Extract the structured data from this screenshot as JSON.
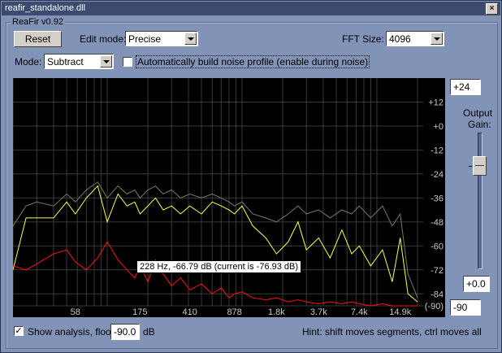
{
  "window": {
    "title": "reafir_standalone.dll",
    "close_glyph": "×"
  },
  "group_label": "ReaFir v0.92",
  "toolbar": {
    "reset_label": "Reset",
    "edit_mode_label": "Edit mode:",
    "edit_mode_value": "Precise",
    "fft_label": "FFT Size:",
    "fft_value": "4096",
    "mode_label": "Mode:",
    "mode_value": "Subtract",
    "auto_label": "Automatically build noise profile (enable during noise)",
    "auto_checked": ""
  },
  "output": {
    "max_value": "+24",
    "label_line1": "Output",
    "label_line2": "Gain:",
    "gain_value": "+0.0",
    "min_value": "-90"
  },
  "footer": {
    "show_check": "✓",
    "show_label": "Show analysis, floor:",
    "floor_value": "-90.0",
    "db_label": "dB",
    "hint": "Hint: shift moves segments, ctrl moves all"
  },
  "tooltip_text": "228 Hz,  -66.79 dB (current is -76.93 dB)",
  "colors": {
    "analysis": "#ffff44",
    "profile": "#ff1010",
    "prev": "#7a7a5a",
    "grid": "#3a3a3a"
  },
  "chart_data": {
    "type": "line",
    "xlabels": [
      {
        "f": 58,
        "label": "58"
      },
      {
        "f": 175,
        "label": "175"
      },
      {
        "f": 410,
        "label": "410"
      },
      {
        "f": 878,
        "label": "878"
      },
      {
        "f": 1800,
        "label": "1.8k"
      },
      {
        "f": 3700,
        "label": "3.7k"
      },
      {
        "f": 7400,
        "label": "7.4k"
      },
      {
        "f": 14900,
        "label": "14.9k"
      }
    ],
    "ylabels": [
      {
        "v": 12,
        "label": "+12"
      },
      {
        "v": 0,
        "label": "+0"
      },
      {
        "v": -12,
        "label": "-12"
      },
      {
        "v": -24,
        "label": "-24"
      },
      {
        "v": -36,
        "label": "-36"
      },
      {
        "v": -48,
        "label": "-48"
      },
      {
        "v": -60,
        "label": "-60"
      },
      {
        "v": -72,
        "label": "-72"
      },
      {
        "v": -84,
        "label": "-84"
      },
      {
        "v": -90,
        "label": "(-90)"
      }
    ],
    "xrange": [
      20,
      22050
    ],
    "yrange": [
      -90,
      24
    ],
    "xscale": "log",
    "profile": {
      "x": [
        20,
        25,
        30,
        40,
        50,
        58,
        70,
        85,
        100,
        120,
        140,
        160,
        175,
        200,
        228,
        260,
        300,
        350,
        410,
        500,
        600,
        700,
        800,
        878,
        1000,
        1200,
        1500,
        1800,
        2200,
        2600,
        3000,
        3700,
        4500,
        5500,
        6500,
        7400,
        9000,
        11000,
        13000,
        14900,
        17000,
        20000
      ],
      "y": [
        -70,
        -72,
        -69,
        -64,
        -62,
        -68,
        -72,
        -66,
        -58,
        -67,
        -72,
        -76,
        -70,
        -78,
        -67,
        -74,
        -80,
        -76,
        -82,
        -79,
        -84,
        -81,
        -86,
        -84,
        -83,
        -86,
        -87,
        -86,
        -88,
        -87,
        -88,
        -89,
        -88,
        -89,
        -88,
        -89,
        -90,
        -89,
        -90,
        -90,
        -90,
        -90
      ]
    },
    "analysis": {
      "x": [
        20,
        25,
        30,
        40,
        50,
        58,
        70,
        85,
        100,
        120,
        140,
        160,
        175,
        200,
        228,
        260,
        300,
        350,
        410,
        500,
        600,
        700,
        800,
        878,
        1000,
        1200,
        1500,
        1800,
        2200,
        2600,
        3000,
        3700,
        4500,
        5500,
        6500,
        7400,
        9000,
        11000,
        13000,
        14900,
        17000,
        20000
      ],
      "y": [
        -72,
        -46,
        -46,
        -46,
        -38,
        -44,
        -36,
        -30,
        -48,
        -34,
        -40,
        -38,
        -44,
        -40,
        -36,
        -42,
        -40,
        -44,
        -40,
        -44,
        -38,
        -40,
        -42,
        -44,
        -40,
        -50,
        -56,
        -64,
        -58,
        -48,
        -62,
        -56,
        -66,
        -52,
        -64,
        -60,
        -70,
        -62,
        -78,
        -56,
        -84,
        -88
      ]
    },
    "previous": {
      "x": [
        20,
        25,
        30,
        40,
        50,
        58,
        70,
        85,
        100,
        120,
        140,
        160,
        175,
        200,
        228,
        260,
        300,
        350,
        410,
        500,
        600,
        700,
        800,
        878,
        1000,
        1200,
        1500,
        1800,
        2200,
        2600,
        3000,
        3700,
        4500,
        5500,
        6500,
        7400,
        9000,
        11000,
        13000,
        14900,
        17000,
        20000
      ],
      "y": [
        -50,
        -40,
        -38,
        -40,
        -34,
        -38,
        -32,
        -28,
        -36,
        -30,
        -34,
        -32,
        -36,
        -32,
        -30,
        -34,
        -32,
        -36,
        -34,
        -36,
        -34,
        -36,
        -38,
        -40,
        -38,
        -44,
        -46,
        -48,
        -44,
        -40,
        -44,
        -42,
        -46,
        -42,
        -44,
        -40,
        -46,
        -40,
        -50,
        -44,
        -74,
        -86
      ]
    }
  }
}
